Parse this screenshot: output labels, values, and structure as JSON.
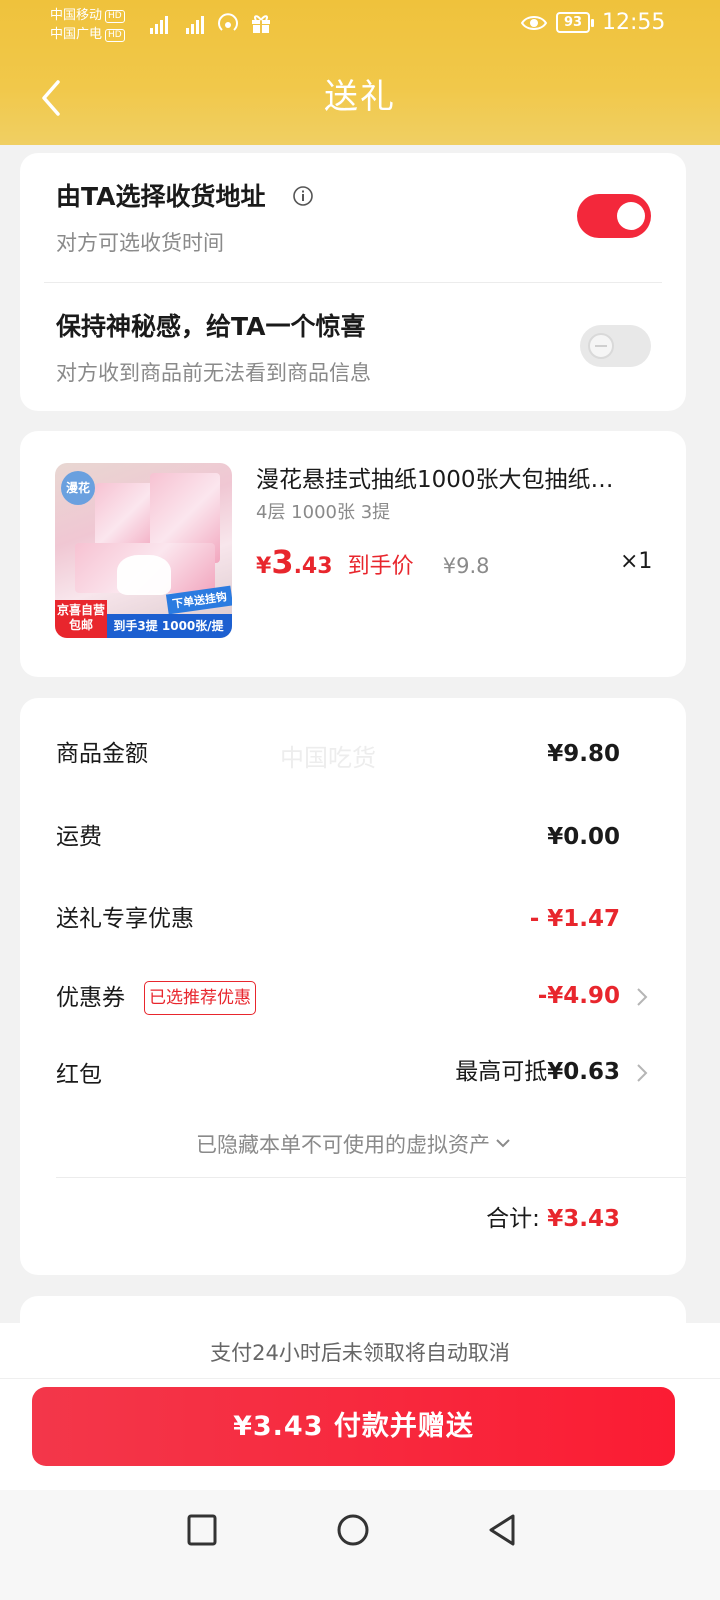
{
  "status_bar": {
    "carrier1": "中国移动",
    "carrier2": "中国广电",
    "hd": "HD",
    "network": "4G",
    "battery": "93",
    "time": "12:55"
  },
  "header": {
    "title": "送礼"
  },
  "options": {
    "address": {
      "title": "由TA选择收货地址",
      "subtitle": "对方可选收货时间",
      "enabled": true
    },
    "mystery": {
      "title": "保持神秘感，给TA一个惊喜",
      "subtitle": "对方收到商品前无法看到商品信息",
      "enabled": false
    }
  },
  "product": {
    "name": "漫花悬挂式抽纸1000张大包抽纸…",
    "spec": "4层 1000张 3提",
    "price_currency": "¥",
    "price_int": "3",
    "price_dec": ".43",
    "price_label": "到手价",
    "original_price": "¥9.8",
    "quantity": "×1",
    "image_text": {
      "brand": "漫花",
      "promo_top": "下单送挂钩",
      "promo_bottom": "到手3提 1000张/提",
      "badge": "京喜自营 包邮"
    }
  },
  "fees": {
    "watermark": "中国吃货",
    "goods_label": "商品金额",
    "goods_value": "¥9.80",
    "shipping_label": "运费",
    "shipping_value": "¥0.00",
    "gift_discount_label": "送礼专享优惠",
    "gift_discount_value": "- ¥1.47",
    "coupon_label": "优惠券",
    "coupon_tag": "已选推荐优惠",
    "coupon_value": "-¥4.90",
    "redpacket_label": "红包",
    "redpacket_prefix": "最高可抵",
    "redpacket_value": "¥0.63",
    "hidden_assets": "已隐藏本单不可使用的虚拟资产",
    "total_label": "合计:",
    "total_value": "¥3.43"
  },
  "footer": {
    "notice": "支付24小时后未领取将自动取消",
    "pay_button": "¥3.43 付款并赠送"
  },
  "colors": {
    "header_yellow": "#efc23c",
    "accent_red": "#e8262d",
    "toggle_on": "#f3283b"
  }
}
